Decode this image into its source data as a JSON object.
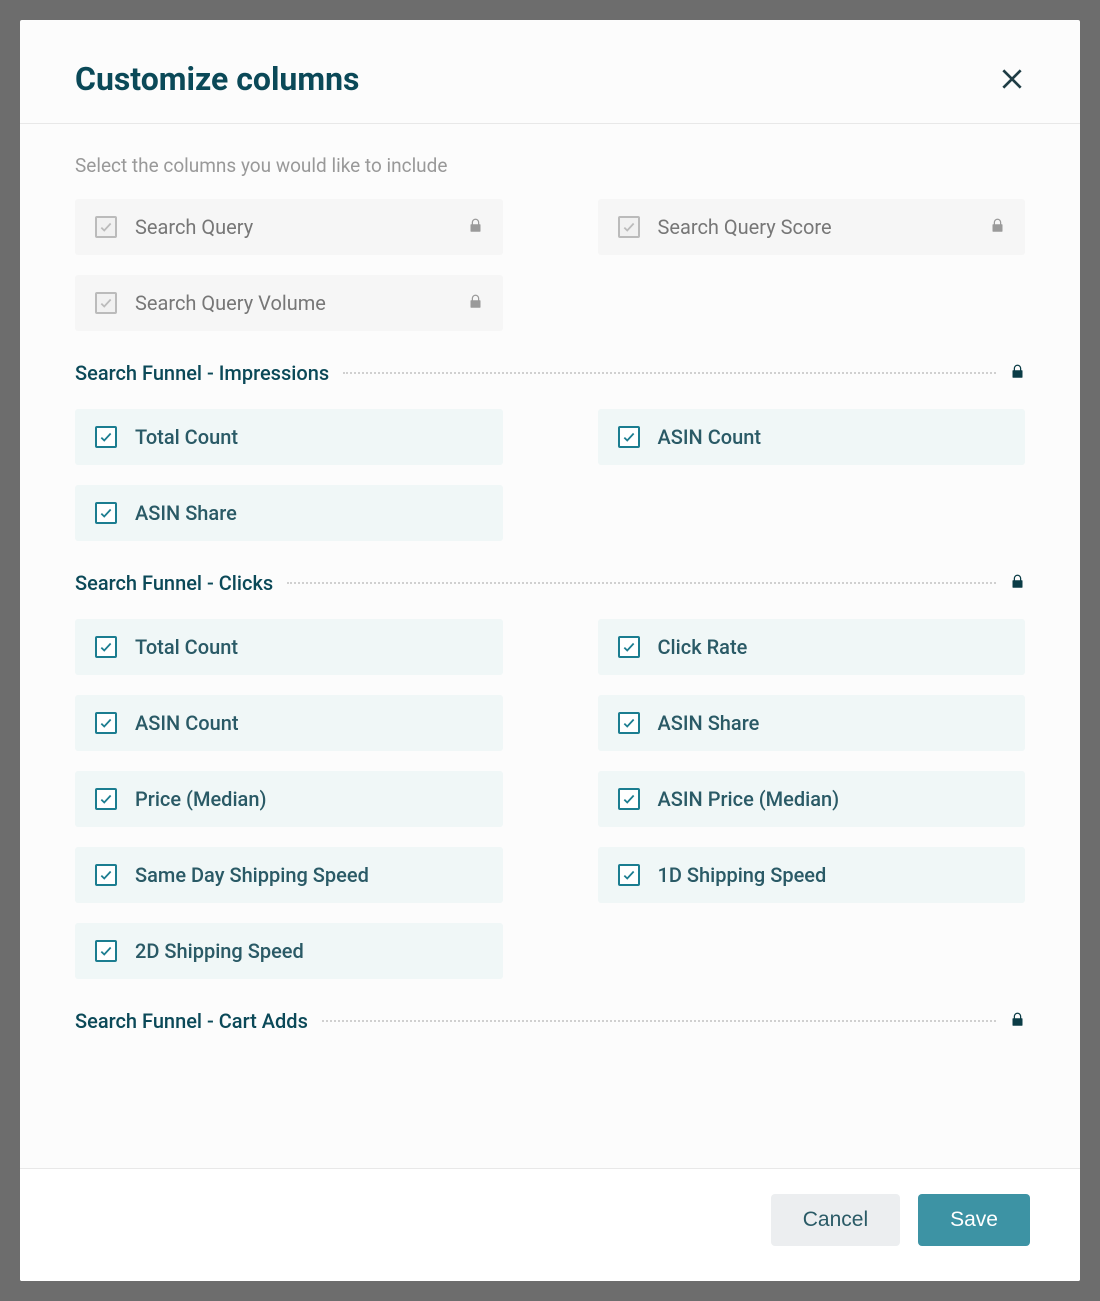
{
  "modal": {
    "title": "Customize columns",
    "subtitle": "Select the columns you would like to include",
    "sections": {
      "locked": {
        "items": [
          {
            "label": "Search Query"
          },
          {
            "label": "Search Query Score"
          },
          {
            "label": "Search Query Volume"
          }
        ]
      },
      "impressions": {
        "title": "Search Funnel - Impressions",
        "items": [
          {
            "label": "Total Count"
          },
          {
            "label": "ASIN Count"
          },
          {
            "label": "ASIN Share"
          }
        ]
      },
      "clicks": {
        "title": "Search Funnel - Clicks",
        "items": [
          {
            "label": "Total Count"
          },
          {
            "label": "Click Rate"
          },
          {
            "label": "ASIN Count"
          },
          {
            "label": "ASIN Share"
          },
          {
            "label": "Price (Median)"
          },
          {
            "label": "ASIN Price (Median)"
          },
          {
            "label": "Same Day Shipping Speed"
          },
          {
            "label": "1D Shipping Speed"
          },
          {
            "label": "2D Shipping Speed"
          }
        ]
      },
      "cartadds": {
        "title": "Search Funnel - Cart Adds"
      }
    },
    "actions": {
      "cancel": "Cancel",
      "save": "Save"
    }
  }
}
